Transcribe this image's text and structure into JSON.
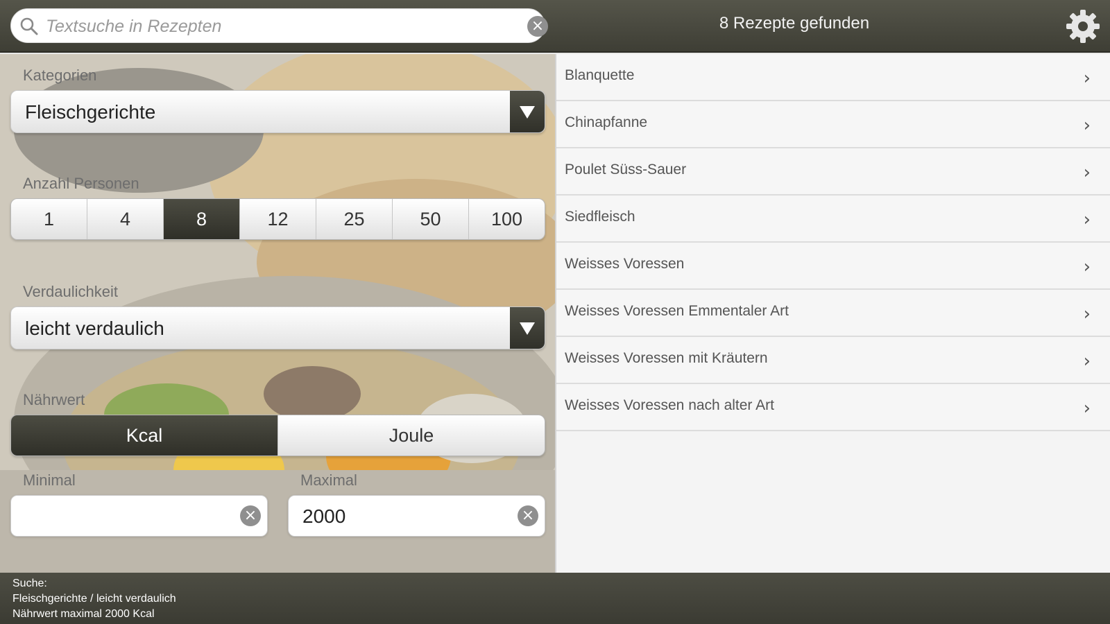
{
  "search": {
    "placeholder": "Textsuche in Rezepten",
    "value": ""
  },
  "header": {
    "found_label": "8 Rezepte gefunden"
  },
  "filters": {
    "category": {
      "label": "Kategorien",
      "value": "Fleischgerichte"
    },
    "persons": {
      "label": "Anzahl Personen",
      "options": [
        "1",
        "4",
        "8",
        "12",
        "25",
        "50",
        "100"
      ],
      "selected": "8"
    },
    "digestibility": {
      "label": "Verdaulichkeit",
      "value": "leicht verdaulich"
    },
    "nutrition": {
      "label": "Nährwert",
      "options": [
        "Kcal",
        "Joule"
      ],
      "selected": "Kcal"
    },
    "minimal": {
      "label": "Minimal",
      "value": ""
    },
    "maximal": {
      "label": "Maximal",
      "value": "2000"
    }
  },
  "results": [
    "Blanquette",
    "Chinapfanne",
    "Poulet Süss-Sauer",
    "Siedfleisch",
    "Weisses Voressen",
    "Weisses Voressen Emmentaler Art",
    "Weisses Voressen mit Kräutern",
    "Weisses Voressen nach alter Art"
  ],
  "status": {
    "title": "Suche:",
    "line1": "Fleischgerichte / leicht verdaulich",
    "line2": "Nährwert maximal 2000 Kcal"
  },
  "colors": {
    "bar_dark": "#3e3e35",
    "accent_dark": "#2f2f28",
    "list_bg": "#f6f6f6"
  },
  "icons": {
    "search": "search-icon",
    "clear": "clear-icon",
    "settings": "gear-icon",
    "dropdown": "triangle-down-icon",
    "chevron": "chevron-right-icon"
  }
}
